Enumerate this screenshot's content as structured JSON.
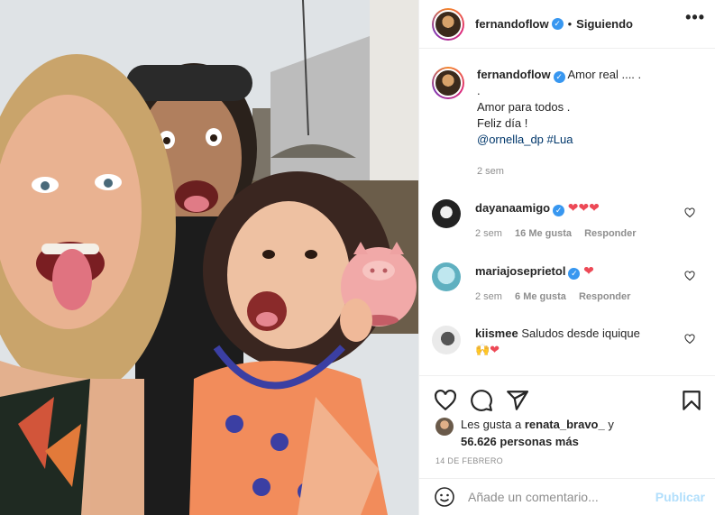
{
  "post": {
    "author": "fernandoflow",
    "follow_label": "Siguiendo",
    "separator": "•",
    "more_label": "•••",
    "caption": {
      "author": "fernandoflow",
      "lines": [
        "Amor real .... .",
        ".",
        "Amor para todos .",
        "Feliz día !"
      ],
      "mention": "@ornella_dp",
      "hashtag": "#Lua",
      "time": "2 sem"
    },
    "comments": [
      {
        "user": "dayanaamigo",
        "verified": true,
        "text": "",
        "hearts": "❤❤❤",
        "time": "2 sem",
        "likes": "16 Me gusta",
        "reply": "Responder"
      },
      {
        "user": "mariajoseprietol",
        "verified": true,
        "text": "",
        "hearts": "❤",
        "time": "2 sem",
        "likes": "6 Me gusta",
        "reply": "Responder"
      },
      {
        "user": "kiismee",
        "verified": false,
        "text": "Saludos desde iquique",
        "emoji_line": "🙌❤"
      }
    ],
    "likes": {
      "prefix": "Les gusta a",
      "user": "renata_bravo_",
      "conj": "y",
      "count": "56.626 personas más"
    },
    "date": "14 DE FEBRERO",
    "composer": {
      "placeholder": "Añade un comentario...",
      "publish": "Publicar"
    },
    "icons": {
      "verified": "verified-badge-icon",
      "like": "heart-icon",
      "comment": "comment-icon",
      "share": "paper-plane-icon",
      "save": "bookmark-icon",
      "emoji": "smiley-icon",
      "more": "more-options-icon"
    },
    "colors": {
      "link": "#00376b",
      "verified": "#3897f0",
      "heart": "#ed4956",
      "publish_disabled": "#b2dffc"
    }
  }
}
